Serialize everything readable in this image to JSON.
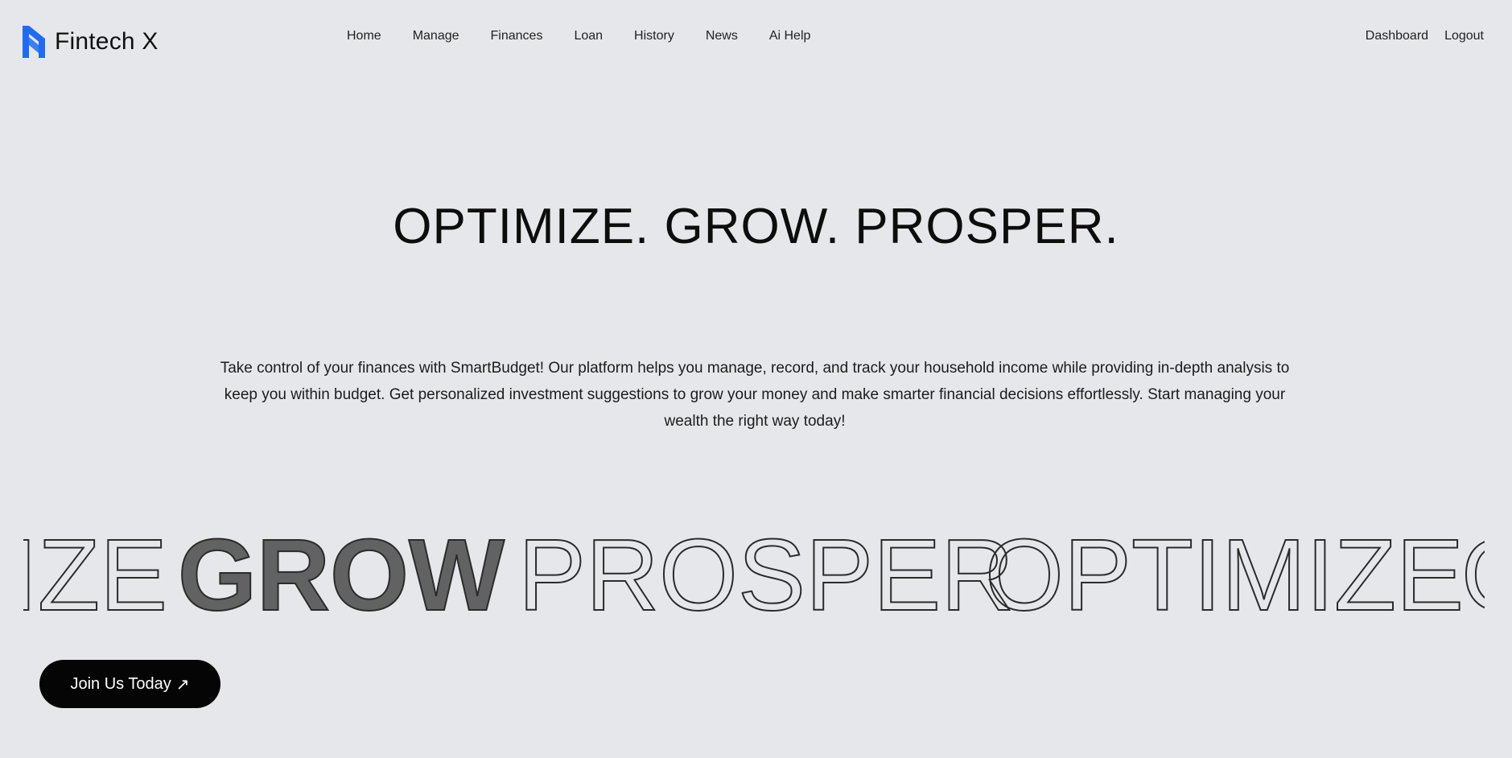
{
  "brand": {
    "name": "Fintech X",
    "logo_icon": "fintech-x-logo-icon",
    "logo_color": "#1f6cf3"
  },
  "nav": {
    "items": [
      {
        "label": "Home"
      },
      {
        "label": "Manage"
      },
      {
        "label": "Finances"
      },
      {
        "label": "Loan"
      },
      {
        "label": "History"
      },
      {
        "label": "News"
      },
      {
        "label": "Ai Help"
      }
    ]
  },
  "auth": {
    "dashboard_label": "Dashboard",
    "logout_label": "Logout"
  },
  "hero": {
    "title": "OPTIMIZE. GROW. PROSPER.",
    "description": "Take control of your finances with SmartBudget! Our platform helps you manage, record, and track your household income while providing in-depth analysis to keep you within budget. Get personalized investment suggestions to grow your money and make smarter financial decisions effortlessly. Start managing your wealth the right way today!"
  },
  "marquee": {
    "words": [
      {
        "text": "IZE",
        "style": "outline"
      },
      {
        "text": "GROW",
        "style": "filled"
      },
      {
        "text": "PROSPER",
        "style": "outline"
      },
      {
        "text": "OPTIMIZE",
        "style": "outline"
      },
      {
        "text": "O",
        "style": "outline"
      }
    ],
    "fill_color": "#626262",
    "stroke_color": "#2b2b2b"
  },
  "cta": {
    "label": "Join Us Today",
    "icon": "arrow-up-right-icon"
  }
}
